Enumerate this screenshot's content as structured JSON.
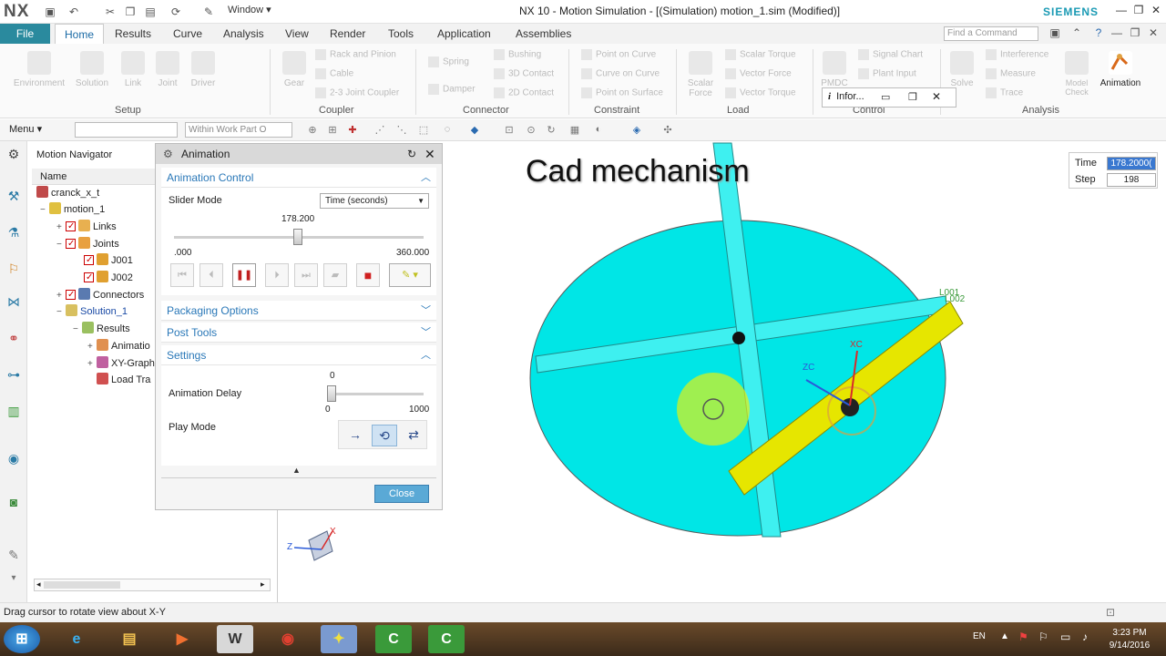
{
  "titlebar": {
    "logo": "NX",
    "window_menu": "Window ▾",
    "title": "NX 10 - Motion Simulation - [(Simulation) motion_1.sim (Modified)]",
    "brand": "SIEMENS"
  },
  "tabs": {
    "file": "File",
    "items": [
      "Home",
      "Results",
      "Curve",
      "Analysis",
      "View",
      "Render",
      "Tools",
      "Application",
      "Assemblies"
    ],
    "find_placeholder": "Find a Command"
  },
  "ribbon": {
    "setup": {
      "buttons": [
        "Environment",
        "Solution",
        "Link",
        "Joint",
        "Driver"
      ],
      "label": "Setup"
    },
    "coupler": {
      "buttons": [
        "Gear"
      ],
      "items": [
        "Rack and Pinion",
        "Cable",
        "2-3 Joint Coupler"
      ],
      "label": "Coupler"
    },
    "connector": {
      "items": [
        "Spring",
        "Damper",
        "Bushing",
        "3D Contact",
        "2D Contact"
      ],
      "label": "Connector"
    },
    "constraint": {
      "items": [
        "Point on Curve",
        "Curve on Curve",
        "Point on Surface"
      ],
      "label": "Constraint"
    },
    "load": {
      "buttons": [
        "Scalar Force"
      ],
      "items": [
        "Scalar Torque",
        "Vector Force",
        "Vector Torque"
      ],
      "label": "Load"
    },
    "control": {
      "buttons": [
        "PMDC"
      ],
      "items": [
        "Signal Chart",
        "Plant Input"
      ],
      "label": "Control"
    },
    "analysis": {
      "buttons": [
        "Solve",
        "Model Check",
        "Animation"
      ],
      "items": [
        "Interference",
        "Measure",
        "Trace"
      ],
      "label": "Analysis"
    }
  },
  "toolbar": {
    "menu": "Menu ▾",
    "filter_value": "",
    "scope": "Within Work Part O"
  },
  "navigator": {
    "title": "Motion Navigator",
    "column": "Name",
    "tree": [
      "cranck_x_t",
      "motion_1",
      "Links",
      "Joints",
      "J001",
      "J002",
      "Connectors",
      "Solution_1",
      "Results",
      "Animatio",
      "XY-Graph",
      "Load Tra"
    ]
  },
  "animation_dialog": {
    "title": "Animation",
    "animation_control": "Animation Control",
    "slider_mode_label": "Slider Mode",
    "slider_mode_value": "Time (seconds)",
    "slider_current": "178.200",
    "slider_min": ".000",
    "slider_max": "360.000",
    "slider_fraction": 0.495,
    "packaging_options": "Packaging Options",
    "post_tools": "Post Tools",
    "settings": "Settings",
    "animation_delay_label": "Animation Delay",
    "delay_value": "0",
    "delay_min": "0",
    "delay_max": "1000",
    "play_mode_label": "Play Mode",
    "close": "Close"
  },
  "info_window": {
    "title": "Infor..."
  },
  "viewport": {
    "overlay_title": "Cad mechanism",
    "time_label": "Time",
    "time_value": "178.2000(",
    "step_label": "Step",
    "step_value": "198",
    "axis_x": "X",
    "axis_z": "Z",
    "labels": {
      "l001": "L001",
      "l002": "L002",
      "xc": "XC",
      "zc": "ZC"
    }
  },
  "status": {
    "message": "Drag cursor to rotate view about X-Y"
  },
  "taskbar": {
    "lang": "EN",
    "time": "3:23 PM",
    "date": "9/14/2016"
  },
  "colors": {
    "disk": "#00e6e6",
    "slider_bar": "#e6e600",
    "accent": "#2a8a9e",
    "brand": "#1a9ab4"
  }
}
